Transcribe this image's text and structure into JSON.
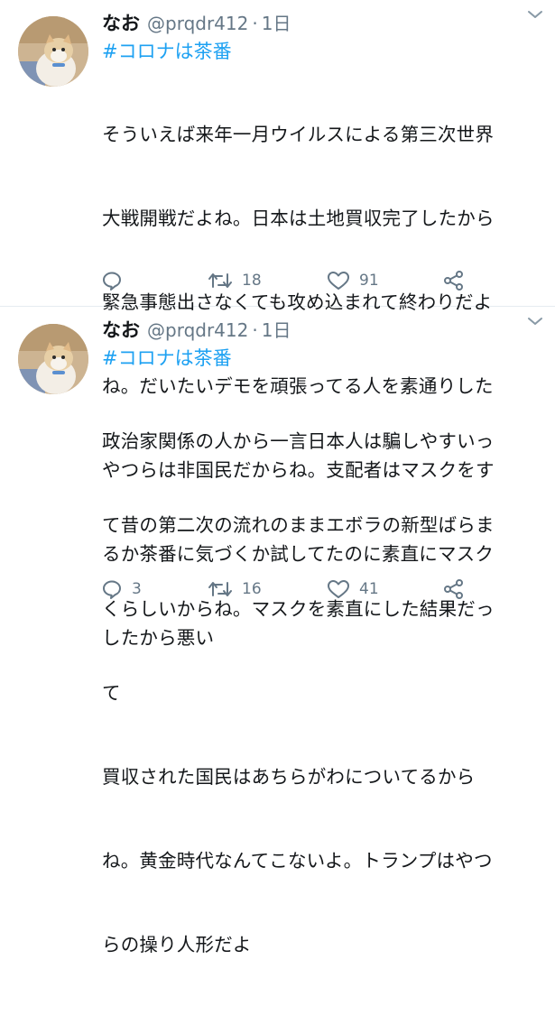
{
  "tweets": [
    {
      "name": "なお",
      "handle": "@prqdr412",
      "dot": "·",
      "time": "1日",
      "hashtag": "#コロナは茶番",
      "lines": [
        "そういえば来年一月ウイルスによる第三次世界",
        "大戦開戦だよね。日本は土地買収完了したから",
        "緊急事態出さなくても攻め込まれて終わりだよ",
        "ね。だいたいデモを頑張ってる人を素通りした",
        "やつらは非国民だからね。支配者はマスクをす",
        "るか茶番に気づくか試してたのに素直にマスク",
        "したから悪い"
      ],
      "reply_count": "",
      "retweet_count": "18",
      "like_count": "91",
      "icons": {
        "reply": "reply-icon",
        "retweet": "retweet-icon",
        "like": "heart-icon",
        "share": "share-icon",
        "menu": "chevron-down-icon"
      }
    },
    {
      "name": "なお",
      "handle": "@prqdr412",
      "dot": "·",
      "time": "1日",
      "hashtag": "#コロナは茶番",
      "lines": [
        "政治家関係の人から一言日本人は騙しやすいっ",
        "て昔の第二次の流れのままエボラの新型ばらま",
        "くらしいからね。マスクを素直にした結果だっ",
        "て",
        "買収された国民はあちらがわについてるから",
        "ね。黄金時代なんてこないよ。トランプはやつ",
        "らの操り人形だよ"
      ],
      "reply_count": "3",
      "retweet_count": "16",
      "like_count": "41",
      "icons": {
        "reply": "reply-icon",
        "retweet": "retweet-icon",
        "like": "heart-icon",
        "share": "share-icon",
        "menu": "chevron-down-icon"
      }
    }
  ],
  "colors": {
    "accent": "#1da1f2",
    "secondary_text": "#657786",
    "divider": "#e6ecf0"
  }
}
